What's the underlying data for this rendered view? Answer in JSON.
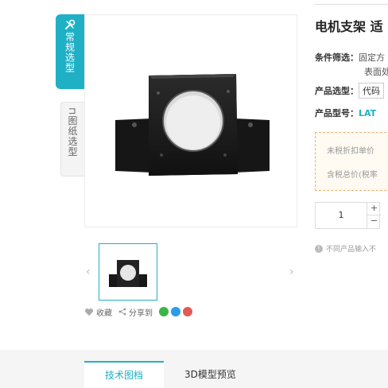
{
  "sidebar": {
    "tab_regular": "常规选型",
    "tab_drawing_icon": "⊓",
    "tab_drawing": "图纸选型",
    "tab_regular_icon": "wrench-icon"
  },
  "gallery": {
    "prev": "‹",
    "next": "›"
  },
  "social": {
    "favorite": "收藏",
    "share": "分享到",
    "icons": [
      "wechat-icon",
      "qq-icon",
      "weibo-icon"
    ],
    "colors": {
      "wechat": "#3bb54a",
      "qq": "#2a9ce8",
      "weibo": "#e25a55"
    }
  },
  "tabs": {
    "tech_drawing": "技术图档",
    "preview_3d": "3D模型预览"
  },
  "product": {
    "title": "电机支架 适",
    "cond_label": "条件筛选：",
    "cond_line1": "固定方",
    "cond_line2": "表面处",
    "select_label": "产品选型：",
    "select_value": "代码",
    "model_label": "产品型号：",
    "model_value": "LAT",
    "price_untaxed": "未税折扣单价",
    "price_taxed": "含税总价(税率",
    "quantity": "1",
    "plus": "+",
    "minus": "−",
    "notice": "不同产品输入不"
  },
  "colors": {
    "accent": "#1fb0c6",
    "price_border": "#f0b070"
  }
}
